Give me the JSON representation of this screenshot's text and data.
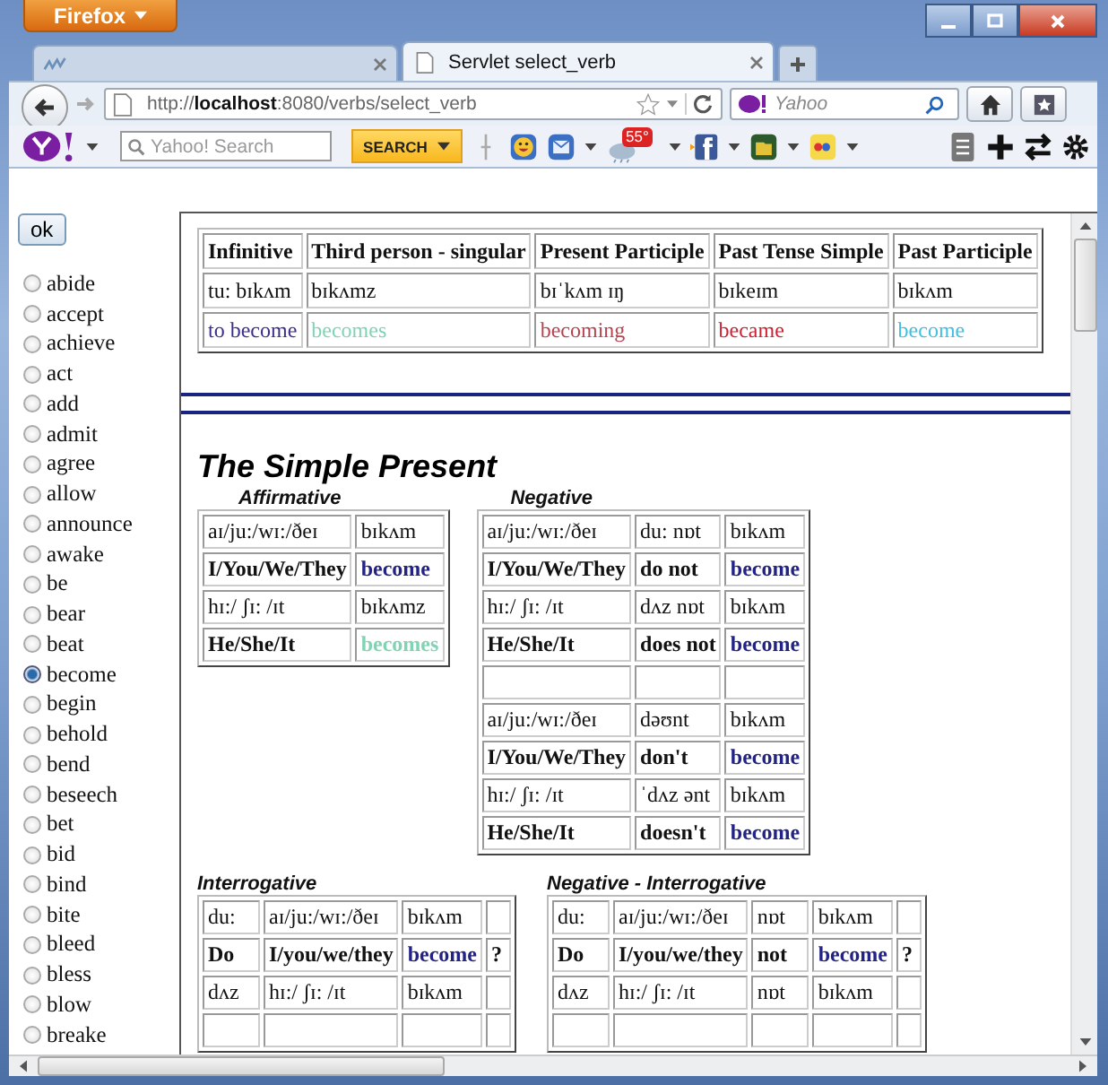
{
  "window": {
    "menu_button": "Firefox"
  },
  "tabs": [
    {
      "selected": false
    },
    {
      "title": "Servlet select_verb",
      "selected": true
    }
  ],
  "address_bar": {
    "url": "http://**localhost**:8080/verbs/select_verb"
  },
  "search_bar": {
    "placeholder": "Yahoo"
  },
  "yahoo_toolbar": {
    "search_placeholder": "Yahoo! Search",
    "search_button": "SEARCH",
    "weather_badge": "55°"
  },
  "sidebar": {
    "button": "ok",
    "verbs": [
      {
        "label": "abide",
        "selected": false
      },
      {
        "label": "accept",
        "selected": false
      },
      {
        "label": "achieve",
        "selected": false
      },
      {
        "label": "act",
        "selected": false
      },
      {
        "label": "add",
        "selected": false
      },
      {
        "label": "admit",
        "selected": false
      },
      {
        "label": "agree",
        "selected": false
      },
      {
        "label": "allow",
        "selected": false
      },
      {
        "label": "announce",
        "selected": false
      },
      {
        "label": "awake",
        "selected": false
      },
      {
        "label": "be",
        "selected": false
      },
      {
        "label": "bear",
        "selected": false
      },
      {
        "label": "beat",
        "selected": false
      },
      {
        "label": "become",
        "selected": true
      },
      {
        "label": "begin",
        "selected": false
      },
      {
        "label": "behold",
        "selected": false
      },
      {
        "label": "bend",
        "selected": false
      },
      {
        "label": "beseech",
        "selected": false
      },
      {
        "label": "bet",
        "selected": false
      },
      {
        "label": "bid",
        "selected": false
      },
      {
        "label": "bind",
        "selected": false
      },
      {
        "label": "bite",
        "selected": false
      },
      {
        "label": "bleed",
        "selected": false
      },
      {
        "label": "bless",
        "selected": false
      },
      {
        "label": "blow",
        "selected": false
      },
      {
        "label": "breake",
        "selected": false
      }
    ]
  },
  "forms_table": {
    "rows": [
      {
        "kind": "header",
        "cells": [
          {
            "text": "Infinitive"
          },
          {
            "text": "Third person - singular"
          },
          {
            "text": "Present Participle"
          },
          {
            "text": "Past Tense Simple"
          },
          {
            "text": "Past Participle"
          }
        ]
      },
      {
        "kind": "plain",
        "cells": [
          {
            "text": "tu: bɪkʌm"
          },
          {
            "text": "bɪkʌmz"
          },
          {
            "text": "bɪˈkʌm ɪŋ"
          },
          {
            "text": "bɪkeɪm"
          },
          {
            "text": "bɪkʌm"
          }
        ]
      },
      {
        "kind": "plain",
        "cells": [
          {
            "text": "to become",
            "color": "#3a2f8f"
          },
          {
            "text": "becomes",
            "color": "#80d4b4"
          },
          {
            "text": "becoming",
            "color": "#b8434f"
          },
          {
            "text": "became",
            "color": "#cc2233"
          },
          {
            "text": "become",
            "color": "#40bfe0"
          }
        ]
      }
    ]
  },
  "section_title": "The Simple Present",
  "upper_tables": [
    {
      "caption": "Affirmative",
      "rows": [
        {
          "kind": "plain",
          "cells": [
            {
              "text": "aɪ/ju:/wɪ:/ðeɪ"
            },
            {
              "text": "bɪkʌm"
            }
          ]
        },
        {
          "kind": "form",
          "cells": [
            {
              "text": "I/You/We/They"
            },
            {
              "text": "become",
              "color": "#232385"
            }
          ]
        },
        {
          "kind": "plain",
          "cells": [
            {
              "text": "hɪ:/ ʃɪ: /ɪt"
            },
            {
              "text": "bɪkʌmz"
            }
          ]
        },
        {
          "kind": "form",
          "cells": [
            {
              "text": "He/She/It"
            },
            {
              "text": "becomes",
              "color": "#80d4b4"
            }
          ]
        }
      ]
    },
    {
      "caption": "Negative",
      "rows": [
        {
          "kind": "plain",
          "cells": [
            {
              "text": "aɪ/ju:/wɪ:/ðeɪ"
            },
            {
              "text": "du: nɒt"
            },
            {
              "text": "bɪkʌm"
            }
          ]
        },
        {
          "kind": "form",
          "cells": [
            {
              "text": "I/You/We/They"
            },
            {
              "text": "do not"
            },
            {
              "text": "become",
              "color": "#232385"
            }
          ]
        },
        {
          "kind": "plain",
          "cells": [
            {
              "text": "hɪ:/ ʃɪ: /ɪt"
            },
            {
              "text": "dʌz nɒt"
            },
            {
              "text": "bɪkʌm"
            }
          ]
        },
        {
          "kind": "form",
          "cells": [
            {
              "text": "He/She/It"
            },
            {
              "text": "does not"
            },
            {
              "text": "become",
              "color": "#232385"
            }
          ]
        },
        {
          "kind": "blank",
          "cells": [
            {},
            {},
            {}
          ]
        },
        {
          "kind": "plain",
          "cells": [
            {
              "text": "aɪ/ju:/wɪ:/ðeɪ"
            },
            {
              "text": "dəʊnt"
            },
            {
              "text": "bɪkʌm"
            }
          ]
        },
        {
          "kind": "form",
          "cells": [
            {
              "text": "I/You/We/They"
            },
            {
              "text": "don't"
            },
            {
              "text": "become",
              "color": "#232385"
            }
          ]
        },
        {
          "kind": "plain",
          "cells": [
            {
              "text": "hɪ:/ ʃɪ: /ɪt"
            },
            {
              "text": "ˈdʌz ənt"
            },
            {
              "text": "bɪkʌm"
            }
          ]
        },
        {
          "kind": "form",
          "cells": [
            {
              "text": "He/She/It"
            },
            {
              "text": "doesn't"
            },
            {
              "text": "become",
              "color": "#232385"
            }
          ]
        }
      ]
    }
  ],
  "lower_tables": [
    {
      "caption": "Interrogative",
      "rows": [
        {
          "kind": "plain",
          "cells": [
            {
              "text": "du:"
            },
            {
              "text": "aɪ/ju:/wɪ:/ðeɪ"
            },
            {
              "text": "bɪkʌm"
            },
            {}
          ]
        },
        {
          "kind": "form",
          "cells": [
            {
              "text": "Do"
            },
            {
              "text": "I/you/we/they"
            },
            {
              "text": "become",
              "color": "#232385"
            },
            {
              "text": "?"
            }
          ]
        },
        {
          "kind": "plain",
          "cells": [
            {
              "text": "dʌz"
            },
            {
              "text": "hɪ:/ ʃɪ: /ɪt"
            },
            {
              "text": "bɪkʌm"
            },
            {}
          ]
        }
      ]
    },
    {
      "caption": "Negative - Interrogative",
      "rows": [
        {
          "kind": "plain",
          "cells": [
            {
              "text": "du:"
            },
            {
              "text": "aɪ/ju:/wɪ:/ðeɪ"
            },
            {
              "text": "nɒt"
            },
            {
              "text": "bɪkʌm"
            },
            {}
          ]
        },
        {
          "kind": "form",
          "cells": [
            {
              "text": "Do"
            },
            {
              "text": "I/you/we/they"
            },
            {
              "text": "not"
            },
            {
              "text": "become",
              "color": "#232385"
            },
            {
              "text": "?"
            }
          ]
        },
        {
          "kind": "plain",
          "cells": [
            {
              "text": "dʌz"
            },
            {
              "text": "hɪ:/ ʃɪ: /ɪt"
            },
            {
              "text": "nɒt"
            },
            {
              "text": "bɪkʌm"
            },
            {}
          ]
        }
      ]
    }
  ]
}
